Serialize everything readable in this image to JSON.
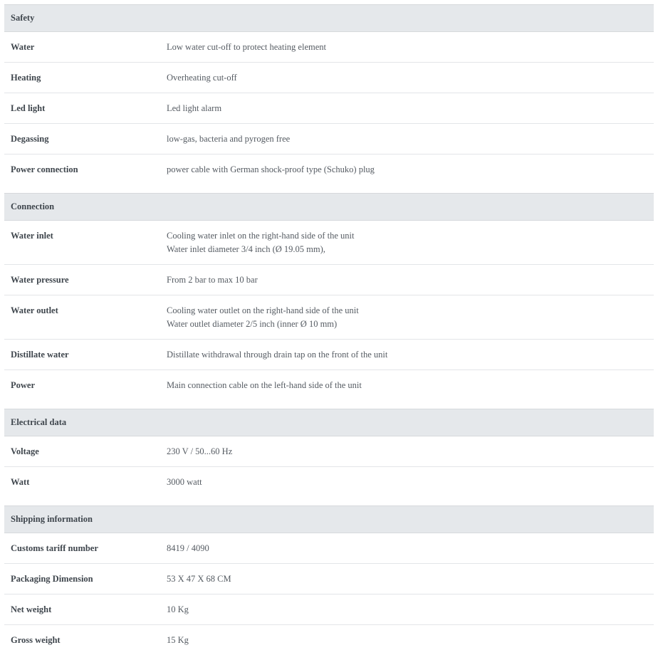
{
  "sections": [
    {
      "title": "Safety",
      "rows": [
        {
          "label": "Water",
          "lines": [
            "Low water cut-off to protect heating element"
          ]
        },
        {
          "label": "Heating",
          "lines": [
            "Overheating cut-off"
          ]
        },
        {
          "label": "Led light",
          "lines": [
            "Led light alarm"
          ]
        },
        {
          "label": "Degassing",
          "lines": [
            "low-gas, bacteria and pyrogen free"
          ]
        },
        {
          "label": "Power connection",
          "lines": [
            "power cable with German shock-proof type (Schuko) plug"
          ]
        }
      ]
    },
    {
      "title": "Connection",
      "rows": [
        {
          "label": "Water inlet",
          "lines": [
            "Cooling water inlet on the right-hand side of the unit",
            "Water inlet diameter 3/4 inch (Ø 19.05 mm),"
          ]
        },
        {
          "label": "Water pressure",
          "lines": [
            "From 2 bar to max 10 bar"
          ]
        },
        {
          "label": "Water outlet",
          "lines": [
            "Cooling water outlet on the right-hand side of the unit",
            "Water outlet diameter 2/5 inch (inner Ø 10 mm)"
          ]
        },
        {
          "label": "Distillate water",
          "lines": [
            "Distillate withdrawal through drain tap on the front of the unit"
          ]
        },
        {
          "label": "Power",
          "lines": [
            "Main connection cable on the left-hand side of the unit"
          ]
        }
      ]
    },
    {
      "title": "Electrical data",
      "rows": [
        {
          "label": "Voltage",
          "lines": [
            "230 V / 50...60 Hz"
          ]
        },
        {
          "label": "Watt",
          "lines": [
            "3000 watt"
          ]
        }
      ]
    },
    {
      "title": "Shipping information",
      "rows": [
        {
          "label": "Customs tariff number",
          "lines": [
            "8419 / 4090"
          ]
        },
        {
          "label": "Packaging Dimension",
          "lines": [
            "53 X 47 X 68 CM"
          ]
        },
        {
          "label": "Net weight",
          "lines": [
            "10 Kg"
          ]
        },
        {
          "label": "Gross weight",
          "lines": [
            "15 Kg"
          ]
        }
      ]
    }
  ]
}
